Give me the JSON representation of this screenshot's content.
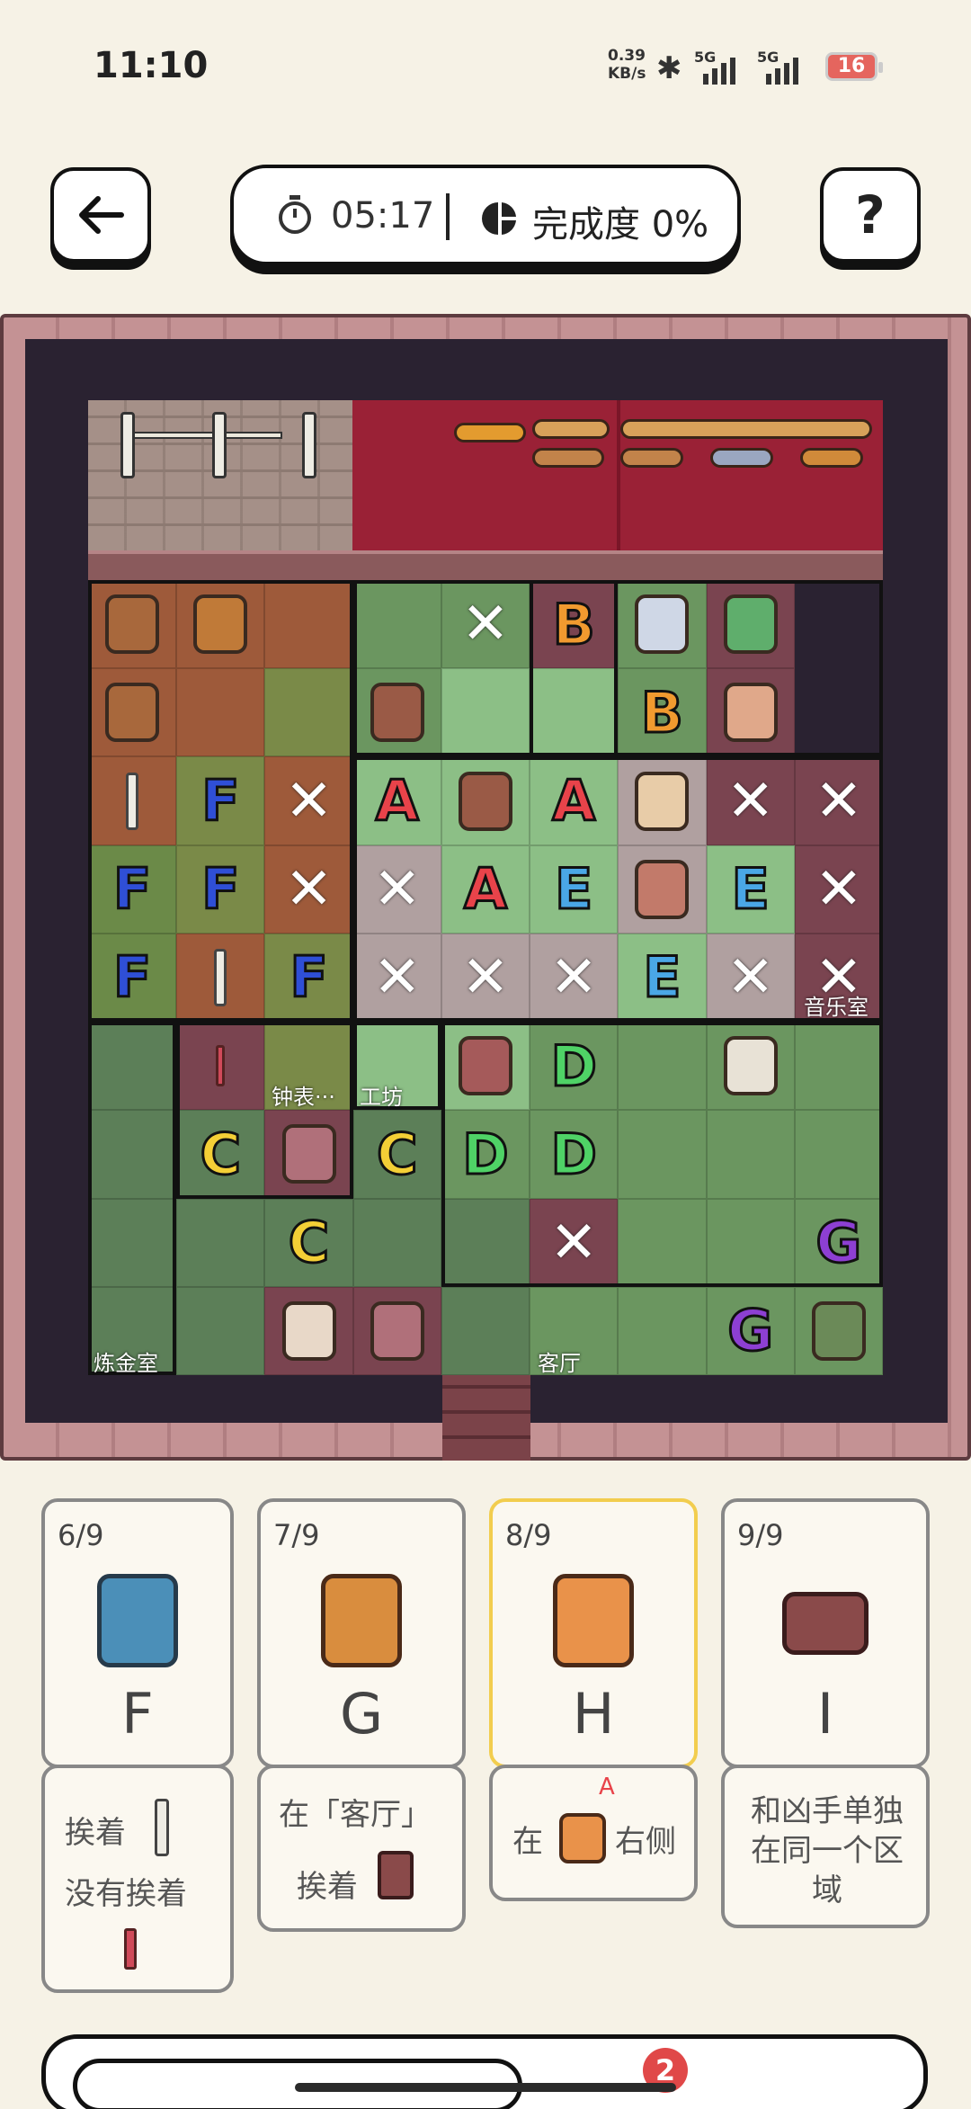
{
  "status_bar": {
    "time": "11:10",
    "net_speed_value": "0.39",
    "net_speed_unit": "KB/s",
    "signal1": "5G",
    "signal2": "5G",
    "battery": "16"
  },
  "header": {
    "timer": "05:17",
    "progress": "完成度 0%"
  },
  "colors": {
    "A": "#e8434a",
    "B": "#f19a2f",
    "C": "#f4cf36",
    "D": "#4fd266",
    "E": "#4aa7e6",
    "F": "#2f4fd6",
    "G": "#8d3fd3"
  },
  "room_labels": {
    "music": "音乐室",
    "clock": "钟表···",
    "workshop": "工坊",
    "alchemy": "炼金室",
    "living": "客厅"
  },
  "board": {
    "rows": [
      [
        "sprite-bed",
        "sprite-barrel",
        "floor",
        "floor",
        "x",
        "B",
        "sprite-ghost",
        "sprite-accordion"
      ],
      [
        "sprite-bed",
        "floor",
        "floor",
        "sprite-chest",
        "floor",
        "floor",
        "B",
        "sprite-stool"
      ],
      [
        "lamp",
        "F",
        "x",
        "A",
        "sprite-desk",
        "A",
        "sprite-paper",
        "x",
        "x"
      ],
      [
        "F",
        "F",
        "x",
        "x",
        "A",
        "E",
        "sprite-man",
        "E",
        "x"
      ],
      [
        "F",
        "lamp",
        "F",
        "x",
        "x",
        "x",
        "E",
        "x",
        "x"
      ],
      [
        "floor",
        "sword",
        "floor",
        "floor",
        "sprite-cabinet",
        "D",
        "floor",
        "sprite-pot",
        "floor"
      ],
      [
        "floor",
        "C",
        "sprite-cauldron",
        "C",
        "D",
        "D",
        "floor",
        "floor",
        "floor"
      ],
      [
        "floor",
        "floor",
        "C",
        "floor",
        "floor",
        "x",
        "floor",
        "floor",
        "G"
      ],
      [
        "floor",
        "floor",
        "sprite-skull",
        "sprite-cauldron2",
        "floor",
        "floor",
        "floor",
        "G",
        "sprite-chair"
      ]
    ]
  },
  "suspects": [
    {
      "count": "6/9",
      "name": "F"
    },
    {
      "count": "7/9",
      "name": "G"
    },
    {
      "count": "8/9",
      "name": "H"
    },
    {
      "count": "9/9",
      "name": "I"
    }
  ],
  "clues": {
    "f_line1": "挨着",
    "f_line2": "没有挨着",
    "g_line1": "在「客厅」",
    "g_line2": "挨着",
    "h_text1": "在",
    "h_mark": "A",
    "h_text2": "右侧",
    "i_text": "和凶手单独在同一个区域"
  },
  "bottom": {
    "badge": "2"
  }
}
